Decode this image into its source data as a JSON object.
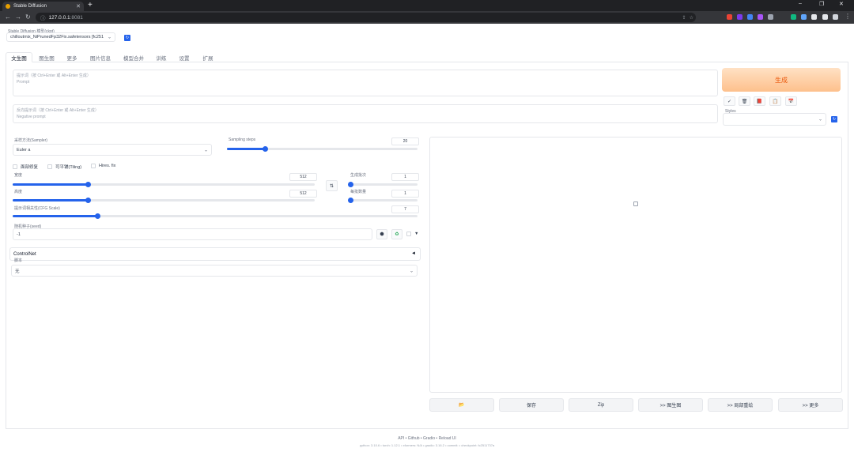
{
  "browser": {
    "tab_title": "Stable Diffusion",
    "tab_close": "✕",
    "new_tab": "+",
    "url_host": "127.0.0.1",
    "url_port": ":8081",
    "win_min": "–",
    "win_max": "❐",
    "win_close": "✕"
  },
  "model": {
    "label": "Stable Diffusion 模型(ckpt)",
    "value": "chilloutmix_NiPrunedFp32Fix.safetensors [fc251",
    "refresh_icon": "refresh-icon"
  },
  "tabs": [
    "文生图",
    "图生图",
    "更多",
    "图片信息",
    "模型合并",
    "训练",
    "设置",
    "扩展"
  ],
  "prompt": {
    "placeholder_line1": "提示词（按 Ctrl+Enter 或 Alt+Enter 生成）",
    "placeholder_line2": "Prompt"
  },
  "negative": {
    "placeholder_line1": "反向提示词（按 Ctrl+Enter 或 Alt+Enter 生成）",
    "placeholder_line2": "Negative prompt"
  },
  "generate_label": "生成",
  "tool_buttons": [
    "✓",
    "🗑",
    "📕",
    "📋",
    "📅"
  ],
  "styles": {
    "label": "Styles",
    "value": ""
  },
  "sampler": {
    "label": "采样方法(Sampler)",
    "value": "Euler a"
  },
  "steps": {
    "label": "Sampling steps",
    "value": "20",
    "fraction": 0.2
  },
  "checks": [
    "面部修复",
    "可平铺(Tiling)",
    "Hires. fix"
  ],
  "width": {
    "label": "宽度",
    "value": "512",
    "fraction": 0.25
  },
  "height": {
    "label": "高度",
    "value": "512",
    "fraction": 0.25
  },
  "swap_label": "⇅",
  "batch_count": {
    "label": "生成批次",
    "value": "1",
    "fraction": 0.0
  },
  "batch_size": {
    "label": "每批数量",
    "value": "1",
    "fraction": 0.0
  },
  "cfg": {
    "label": "提示词相关性(CFG Scale)",
    "value": "7",
    "fraction": 0.21
  },
  "seed": {
    "label": "随机种子(seed)",
    "value": "-1"
  },
  "seed_extra": "▼",
  "controlnet": {
    "label": "ControlNet",
    "toggle": "◄"
  },
  "script": {
    "label": "脚本",
    "value": "无"
  },
  "actions": [
    "📂",
    "保存",
    "Zip",
    ">> 图生图",
    ">> 局部重绘",
    ">> 更多"
  ],
  "footer": {
    "links": "API  •  Github  •  Gradio  •  Reload UI",
    "versions": "python: 3.10.6  •  torch: 1.12.1  •  xformers: N/A  •  gradio: 3.16.2  •  commit:  •  checkpoint: fc2511737a"
  }
}
